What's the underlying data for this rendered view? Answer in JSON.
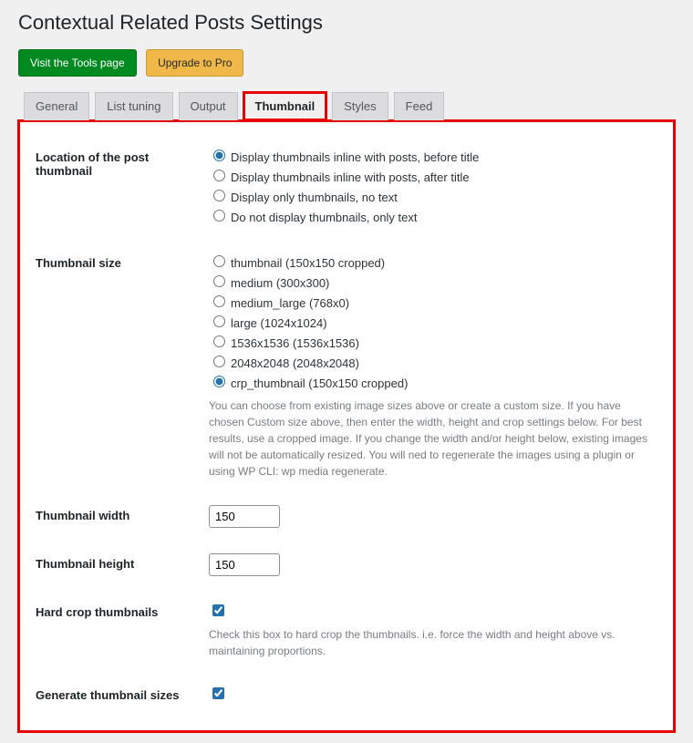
{
  "page_title": "Contextual Related Posts Settings",
  "buttons": {
    "tools": "Visit the Tools page",
    "upgrade": "Upgrade to Pro"
  },
  "tabs": {
    "general": "General",
    "list": "List tuning",
    "output": "Output",
    "thumb": "Thumbnail",
    "styles": "Styles",
    "feed": "Feed"
  },
  "rows": {
    "loc": {
      "label": "Location of the post thumbnail",
      "opts": [
        "Display thumbnails inline with posts, before title",
        "Display thumbnails inline with posts, after title",
        "Display only thumbnails, no text",
        "Do not display thumbnails, only text"
      ],
      "selected": 0
    },
    "size": {
      "label": "Thumbnail size",
      "opts": [
        "thumbnail (150x150 cropped)",
        "medium (300x300)",
        "medium_large (768x0)",
        "large (1024x1024)",
        "1536x1536 (1536x1536)",
        "2048x2048 (2048x2048)",
        "crp_thumbnail (150x150 cropped)"
      ],
      "selected": 6,
      "desc": "You can choose from existing image sizes above or create a custom size. If you have chosen Custom size above, then enter the width, height and crop settings below. For best results, use a cropped image. If you change the width and/or height below, existing images will not be automatically resized. You will ned to regenerate the images using a plugin or using WP CLI: wp media regenerate."
    },
    "tw": {
      "label": "Thumbnail width",
      "value": "150"
    },
    "th": {
      "label": "Thumbnail height",
      "value": "150"
    },
    "crop": {
      "label": "Hard crop thumbnails",
      "checked": true,
      "desc": "Check this box to hard crop the thumbnails. i.e. force the width and height above vs. maintaining proportions."
    },
    "gen": {
      "label": "Generate thumbnail sizes",
      "checked": true
    }
  }
}
